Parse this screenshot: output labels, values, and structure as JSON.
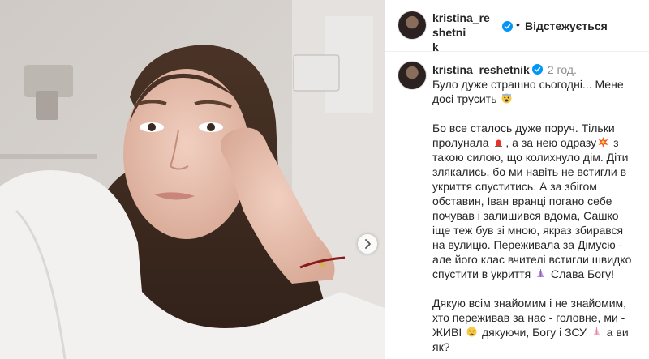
{
  "account": {
    "username_line1": "kristina_reshetni",
    "username_line2": "k",
    "username": "kristina_reshetnik",
    "separator": "•",
    "follow_label": "Відстежується",
    "more_label": "..."
  },
  "post": {
    "time": "2 год.",
    "caption_lines": [
      "Було дуже страшно сьогодні... Мене",
      "досі трусить",
      "",
      "Бо все сталось дуже поруч. Тільки",
      "пролунала , а за нею одразу  з",
      "такою силою, що колихнуло дім. Діти",
      "злякались, бо ми навіть не встигли в",
      "укриття спуститись. А за збігом",
      "обставин, Іван вранці погано себе",
      "почував і залишився вдома, Сашко",
      "іще теж був зі мною, якраз збирався",
      "на вулицю. Переживала за Дімусю -",
      "але його клас вчителі встигли швидко",
      "спустити в укриття  Слава Богу!",
      "",
      "Дякую всім знайомим і не знайомим,",
      "хто переживав за нас - головне, ми -",
      "ЖИВІ  дякуючи, Богу і ЗСУ  а ви",
      "як?"
    ],
    "caption": {
      "l1_user_rest": "Було дуже страшно сьогодні... Мене",
      "l2": "досі трусить",
      "l4": "Бо все сталось дуже поруч. Тільки",
      "l5a": "пролунала",
      "l5b": ", а за нею одразу",
      "l5c": "з",
      "l6": "такою силою, що колихнуло дім. Діти",
      "l7": "злякались, бо ми навіть не встигли в",
      "l8": "укриття спуститись. А за збігом",
      "l9": "обставин, Іван вранці погано себе",
      "l10": "почував і залишився вдома, Сашко",
      "l11": "іще теж був зі мною, якраз збирався",
      "l12": "на вулицю. Переживала за Дімусю -",
      "l13": "але його клас вчителі встигли швидко",
      "l14a": "спустити в укриття",
      "l14b": "Слава Богу!",
      "l16": "Дякую всім знайомим і не знайомим,",
      "l17": "хто переживав за нас - головне, ми -",
      "l18a": "ЖИВІ",
      "l18b": "дякуючи, Богу і ЗСУ",
      "l18c": "а ви",
      "l19": "як?"
    }
  },
  "icons": {
    "verified": "verified-badge-icon",
    "next": "chevron-right-icon",
    "emoji": [
      "scared-emoji-icon",
      "siren-emoji-icon",
      "explosion-emoji-icon",
      "praying-hands-emoji-icon",
      "crying-face-emoji-icon"
    ]
  },
  "colors": {
    "verified_blue": "#0095f6",
    "text": "#262626",
    "muted": "#8e8e8e"
  }
}
